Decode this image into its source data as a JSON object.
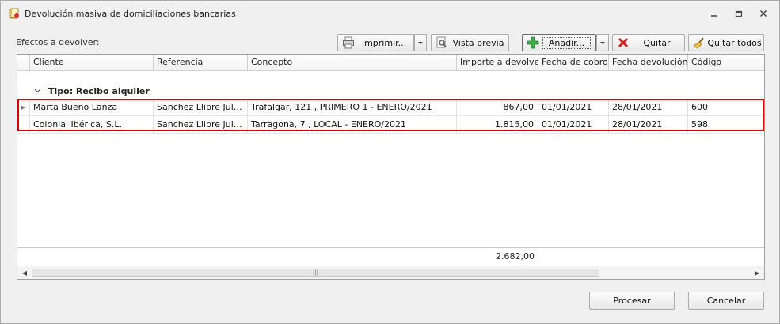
{
  "window": {
    "title": "Devolución masiva de domiciliaciones bancarias"
  },
  "toolbar": {
    "section_label": "Efectos a devolver:",
    "print_label": "Imprimir...",
    "preview_label": "Vista previa",
    "add_label": "Añadir...",
    "remove_label": "Quitar",
    "remove_all_label": "Quitar todos"
  },
  "grid": {
    "columns": [
      "Cliente",
      "Referencia",
      "Concepto",
      "Importe a devolver",
      "Fecha de cobro",
      "Fecha devolución",
      "Código"
    ],
    "group_label": "Tipo: Recibo alquiler",
    "rows": [
      {
        "cliente": "Marta Bueno Lanza",
        "referencia": "Sanchez Llibre Julian ...",
        "concepto": "Trafalgar, 121 , PRIMERO 1 - ENERO/2021",
        "importe": "867,00",
        "fecha_cobro": "01/01/2021",
        "fecha_devolucion": "28/01/2021",
        "codigo": "600"
      },
      {
        "cliente": "Colonial Ibérica, S.L.",
        "referencia": "Sanchez Llibre Julian ...",
        "concepto": "Tarragona, 7 , LOCAL - ENERO/2021",
        "importe": "1.815,00",
        "fecha_cobro": "01/01/2021",
        "fecha_devolucion": "28/01/2021",
        "codigo": "598"
      }
    ],
    "total": "2.682,00",
    "scroll_grip": "|||"
  },
  "buttons": {
    "process_label": "Procesar",
    "cancel_label": "Cancelar"
  },
  "colors": {
    "highlight": "#e00000",
    "add_icon": "#3cb043",
    "remove_icon": "#d42020"
  }
}
